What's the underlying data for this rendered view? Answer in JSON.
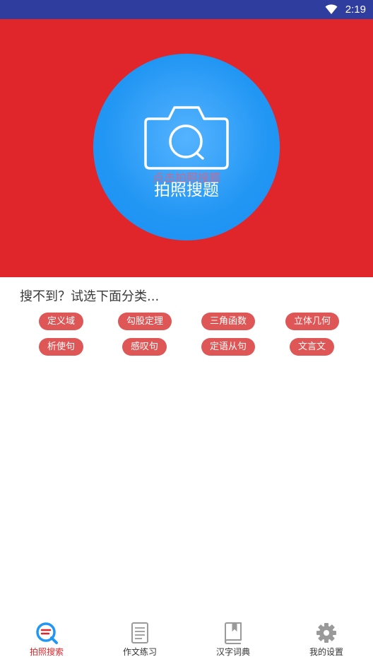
{
  "status_bar": {
    "time": "2:19",
    "icons": [
      "wifi-icon"
    ]
  },
  "hero": {
    "background_color": "#e0262a",
    "circle_color": "#2196f3",
    "icon": "camera-icon",
    "hint": "点击拍照搜题",
    "label": "拍照搜题"
  },
  "categories": {
    "title": "搜不到？试选下面分类...",
    "tag_color": "#de5656",
    "tags": [
      "定义域",
      "勾股定理",
      "三角函数",
      "立体几何",
      "析使句",
      "感叹句",
      "定语从句",
      "文言文"
    ]
  },
  "tabbar": {
    "active_color": "#e0262a",
    "tabs": [
      {
        "label": "拍照搜索",
        "icon": "search-q-icon",
        "active": true
      },
      {
        "label": "作文练习",
        "icon": "document-icon",
        "active": false
      },
      {
        "label": "汉字词典",
        "icon": "book-icon",
        "active": false
      },
      {
        "label": "我的设置",
        "icon": "gear-icon",
        "active": false
      }
    ]
  }
}
